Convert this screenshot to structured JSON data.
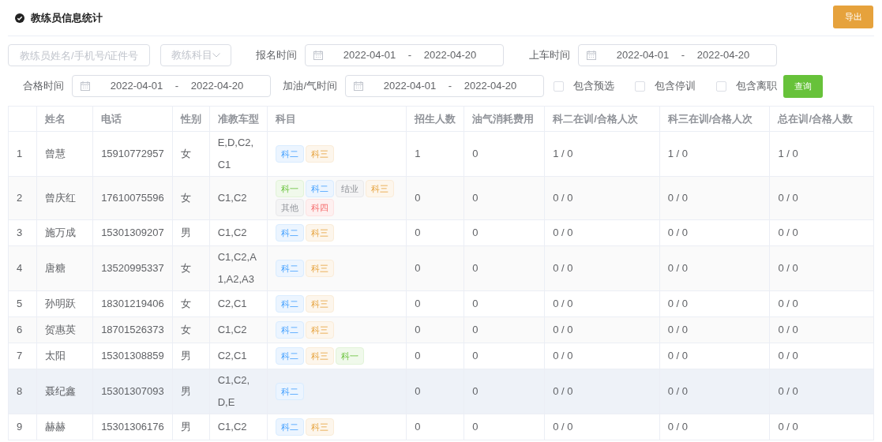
{
  "header": {
    "title": "教练员信息统计",
    "export_button": "导出"
  },
  "filters": {
    "search": {
      "placeholder": "教练员姓名/手机号/证件号"
    },
    "subject_select": {
      "placeholder": "教练科目"
    },
    "ranges": [
      {
        "label": "报名时间",
        "start": "2022-04-01",
        "end": "2022-04-20"
      },
      {
        "label": "上车时间",
        "start": "2022-04-01",
        "end": "2022-04-20"
      },
      {
        "label": "合格时间",
        "start": "2022-04-01",
        "end": "2022-04-20"
      },
      {
        "label": "加油/气时间",
        "start": "2022-04-01",
        "end": "2022-04-20"
      }
    ],
    "separator": "-",
    "checkboxes": [
      {
        "label": "包含预选",
        "checked": false
      },
      {
        "label": "包含停训",
        "checked": false
      },
      {
        "label": "包含离职",
        "checked": false
      }
    ],
    "query_button": "查询"
  },
  "table": {
    "columns": [
      "姓名",
      "电话",
      "性别",
      "准教车型",
      "科目",
      "招生人数",
      "油气消耗费用",
      "科二在训/合格人次",
      "科三在训/合格人次",
      "总在训/合格人数"
    ],
    "rows": [
      {
        "index": "1",
        "name": "曾慧",
        "phone": "15910772957",
        "gender": "女",
        "car_types": "E,D,C2,C1",
        "subjects": [
          {
            "text": "科二",
            "kind": "blue"
          },
          {
            "text": "科三",
            "kind": "orange"
          }
        ],
        "enrolled": "1",
        "fuel_cost": "0",
        "subject2": "1 / 0",
        "subject3": "1 / 0",
        "total": "1 / 0",
        "selected": false
      },
      {
        "index": "2",
        "name": "曾庆红",
        "phone": "17610075596",
        "gender": "女",
        "car_types": "C1,C2",
        "subjects": [
          {
            "text": "科一",
            "kind": "green"
          },
          {
            "text": "科二",
            "kind": "blue"
          },
          {
            "text": "结业",
            "kind": "gray"
          },
          {
            "text": "科三",
            "kind": "orange"
          },
          {
            "text": "其他",
            "kind": "gray"
          },
          {
            "text": "科四",
            "kind": "red"
          }
        ],
        "enrolled": "0",
        "fuel_cost": "0",
        "subject2": "0 / 0",
        "subject3": "0 / 0",
        "total": "0 / 0",
        "selected": false
      },
      {
        "index": "3",
        "name": "施万成",
        "phone": "15301309207",
        "gender": "男",
        "car_types": "C1,C2",
        "subjects": [
          {
            "text": "科二",
            "kind": "blue"
          },
          {
            "text": "科三",
            "kind": "orange"
          }
        ],
        "enrolled": "0",
        "fuel_cost": "0",
        "subject2": "0 / 0",
        "subject3": "0 / 0",
        "total": "0 / 0",
        "selected": false
      },
      {
        "index": "4",
        "name": "唐糖",
        "phone": "13520995337",
        "gender": "女",
        "car_types": "C1,C2,A1,A2,A3",
        "subjects": [
          {
            "text": "科二",
            "kind": "blue"
          },
          {
            "text": "科三",
            "kind": "orange"
          }
        ],
        "enrolled": "0",
        "fuel_cost": "0",
        "subject2": "0 / 0",
        "subject3": "0 / 0",
        "total": "0 / 0",
        "selected": false
      },
      {
        "index": "5",
        "name": "孙明跃",
        "phone": "18301219406",
        "gender": "女",
        "car_types": "C2,C1",
        "subjects": [
          {
            "text": "科二",
            "kind": "blue"
          },
          {
            "text": "科三",
            "kind": "orange"
          }
        ],
        "enrolled": "0",
        "fuel_cost": "0",
        "subject2": "0 / 0",
        "subject3": "0 / 0",
        "total": "0 / 0",
        "selected": false
      },
      {
        "index": "6",
        "name": "贺惠英",
        "phone": "18701526373",
        "gender": "女",
        "car_types": "C1,C2",
        "subjects": [
          {
            "text": "科二",
            "kind": "blue"
          },
          {
            "text": "科三",
            "kind": "orange"
          }
        ],
        "enrolled": "0",
        "fuel_cost": "0",
        "subject2": "0 / 0",
        "subject3": "0 / 0",
        "total": "0 / 0",
        "selected": false
      },
      {
        "index": "7",
        "name": "太阳",
        "phone": "15301308859",
        "gender": "男",
        "car_types": "C2,C1",
        "subjects": [
          {
            "text": "科二",
            "kind": "blue"
          },
          {
            "text": "科三",
            "kind": "orange"
          },
          {
            "text": "科一",
            "kind": "green"
          }
        ],
        "enrolled": "0",
        "fuel_cost": "0",
        "subject2": "0 / 0",
        "subject3": "0 / 0",
        "total": "0 / 0",
        "selected": false
      },
      {
        "index": "8",
        "name": "聂纪鑫",
        "phone": "15301307093",
        "gender": "男",
        "car_types": "C1,C2,D,E",
        "subjects": [
          {
            "text": "科二",
            "kind": "blue"
          }
        ],
        "enrolled": "0",
        "fuel_cost": "0",
        "subject2": "0 / 0",
        "subject3": "0 / 0",
        "total": "0 / 0",
        "selected": true
      },
      {
        "index": "9",
        "name": "赫赫",
        "phone": "15301306176",
        "gender": "男",
        "car_types": "C1,C2",
        "subjects": [
          {
            "text": "科二",
            "kind": "blue"
          },
          {
            "text": "科三",
            "kind": "orange"
          }
        ],
        "enrolled": "0",
        "fuel_cost": "0",
        "subject2": "0 / 0",
        "subject3": "0 / 0",
        "total": "0 / 0",
        "selected": false
      }
    ]
  }
}
